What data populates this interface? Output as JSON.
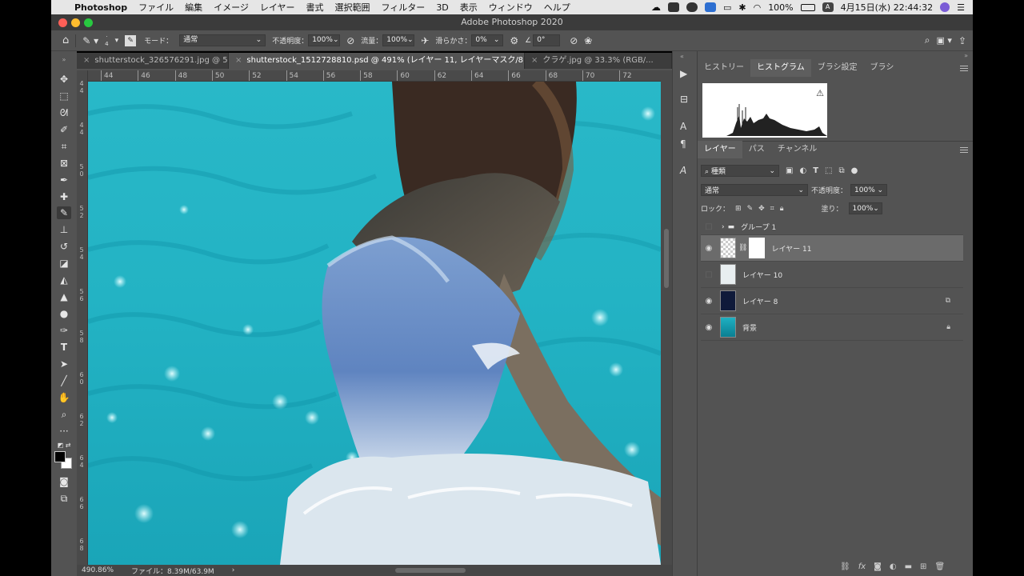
{
  "menubar": {
    "app_name": "Photoshop",
    "items": [
      "ファイル",
      "編集",
      "イメージ",
      "レイヤー",
      "書式",
      "選択範囲",
      "フィルター",
      "3D",
      "表示",
      "ウィンドウ",
      "ヘルプ"
    ],
    "battery": "100%",
    "input_mode": "A",
    "datetime": "4月15日(水) 22:44:32"
  },
  "window": {
    "title": "Adobe Photoshop 2020"
  },
  "options": {
    "brush_size": "4",
    "mode_label": "モード：",
    "mode_value": "通常",
    "opacity_label": "不透明度：",
    "opacity_value": "100%",
    "flow_label": "流量：",
    "flow_value": "100%",
    "smoothing_label": "滑らかさ：",
    "smoothing_value": "0%",
    "angle_value": "0°"
  },
  "tabs": [
    {
      "label": "shutterstock_326576291.jpg @ 5..."
    },
    {
      "label": "shutterstock_1512728810.psd @ 491% (レイヤー 11, レイヤーマスク/8) *"
    },
    {
      "label": "クラゲ.jpg @ 33.3% (RGB/..."
    }
  ],
  "ruler": {
    "h_labels": [
      "44",
      "46",
      "48",
      "50",
      "52",
      "54",
      "56",
      "58",
      "60",
      "62",
      "64",
      "66",
      "68",
      "70",
      "72"
    ],
    "v_labels": [
      "4",
      "4",
      "4",
      "4",
      "5",
      "0",
      "5",
      "2",
      "5",
      "4",
      "5",
      "6",
      "5",
      "8",
      "6",
      "0",
      "6",
      "2",
      "6",
      "4",
      "6",
      "6",
      "6",
      "8"
    ]
  },
  "status": {
    "zoom": "490.86%",
    "file": "ファイル：8.39M/63.9M"
  },
  "panels": {
    "top_tabs": [
      "ヒストリー",
      "ヒストグラム",
      "ブラシ設定",
      "ブラシ"
    ],
    "layer_tabs": [
      "レイヤー",
      "パス",
      "チャンネル"
    ],
    "filter_label": "種類",
    "blend_mode": "通常",
    "opacity_label": "不透明度：",
    "opacity_value": "100%",
    "lock_label": "ロック：",
    "fill_label": "塗り：",
    "fill_value": "100%",
    "layers": [
      {
        "name": "グループ 1",
        "visible": false
      },
      {
        "name": "レイヤー 11",
        "visible": true
      },
      {
        "name": "レイヤー 10",
        "visible": false
      },
      {
        "name": "レイヤー 8",
        "visible": true
      },
      {
        "name": "背景",
        "visible": true
      }
    ]
  },
  "colors": {
    "accent": "#29b8c8",
    "panel_bg": "#535353"
  }
}
